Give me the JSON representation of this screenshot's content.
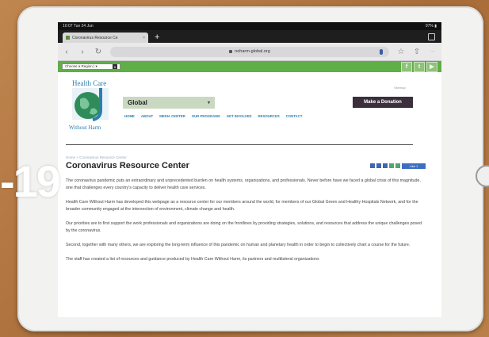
{
  "status_bar": {
    "time": "10:07  Tue 24 Jun",
    "battery": "97% ▮"
  },
  "browser": {
    "tab_title": "Coronavirus Resource Ce",
    "tab_close": "×",
    "new_tab": "+",
    "url": "noharm-global.org",
    "nav_icons": {
      "back": "‹",
      "forward": "›",
      "reload": "↻",
      "star": "☆",
      "share": "⇧",
      "more": "···"
    }
  },
  "site": {
    "language_select": "Choose a Region | ▾",
    "social": [
      "f",
      "t",
      "▶"
    ],
    "sitemap": "Sitemap",
    "logo_top": "Health Care",
    "logo_bottom": "Without Harm",
    "region": "Global",
    "donate": "Make a Donation",
    "nav": [
      "HOME",
      "ABOUT",
      "MEDIA CENTER",
      "OUR PROGRAMS",
      "GET INVOLVED",
      "RESOURCES",
      "CONTACT"
    ],
    "breadcrumb": "Home > Coronavirus Resource Center",
    "title": "Coronavirus Resource Center",
    "like": "Like 1",
    "paragraphs": [
      "The coronavirus pandemic puts an extraordinary and unprecedented burden on health systems, organizations, and professionals. Never before have we faced a global crisis of this magnitude, one that challenges every country's capacity to deliver health care services.",
      "Health Care Without Harm has developed this webpage as a resource center for our members around the world, for members of our Global Green and Healthy Hospitals Network, and for the broader community engaged at the intersection of environment, climate change and health.",
      "Our priorities are to first support the work professionals and organizations are doing on the frontlines by providing strategies, solutions, and resources that address the unique challenges posed by the coronavirus.",
      "Second, together with many others, we are exploring the long-term influence of this pandemic on human and planetary health in order to begin to collectively chart a course for the future.",
      "The staff has created a list of resources and guidance produced by Health Care Without Harm, its partners and multilateral organizations"
    ]
  },
  "overlay_text": "-19",
  "colors": {
    "green_bar": "#5fae46",
    "donate": "#3b2f3c",
    "link": "#2a7fb0"
  }
}
